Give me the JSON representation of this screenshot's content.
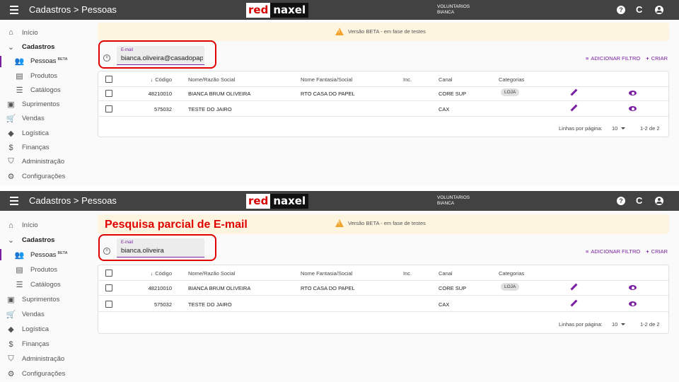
{
  "topbar": {
    "title": "Cadastros > Pessoas",
    "logo_red": "red",
    "logo_dark": "naxel",
    "user_line1": "VOLUNTARIOS",
    "user_line2": "BIANCA",
    "help_icon": "?",
    "refresh_icon": "C"
  },
  "sidebar": {
    "items": [
      {
        "label": "Início",
        "icon": "home-icon",
        "glyph": "⌂"
      },
      {
        "label": "Cadastros",
        "icon": "chevron-down-icon",
        "glyph": "⌄"
      },
      {
        "label": "Pessoas",
        "icon": "people-icon",
        "glyph": "👥",
        "badge": "BETA"
      },
      {
        "label": "Produtos",
        "icon": "book-icon",
        "glyph": "▤"
      },
      {
        "label": "Catálogos",
        "icon": "list-icon",
        "glyph": "☰"
      },
      {
        "label": "Suprimentos",
        "icon": "box-icon",
        "glyph": "▣"
      },
      {
        "label": "Vendas",
        "icon": "cart-icon",
        "glyph": "🛒"
      },
      {
        "label": "Logística",
        "icon": "directions-icon",
        "glyph": "◆"
      },
      {
        "label": "Finanças",
        "icon": "money-icon",
        "glyph": "$"
      },
      {
        "label": "Administração",
        "icon": "shield-icon",
        "glyph": "⛉"
      },
      {
        "label": "Configurações",
        "icon": "gear-icon",
        "glyph": "⚙"
      }
    ]
  },
  "banner": {
    "text": "Versão BETA - em fase de testes"
  },
  "annotation": "Pesquisa parcial de E-mail",
  "filter": {
    "label": "E-mail",
    "value_top": "bianca.oliveira@casadopap",
    "value_bottom": "bianca.oliveira"
  },
  "actions": {
    "add_filter": "ADICIONAR FILTRO",
    "create": "CRIAR"
  },
  "table": {
    "headers": {
      "code": "Código",
      "name": "Nome/Razão Social",
      "fantasy": "Nome Fantasia/Social",
      "inc": "Inc.",
      "canal": "Canal",
      "cat": "Categorias"
    },
    "rows": [
      {
        "code": "48210010",
        "name": "BIANCA BRUM OLIVEIRA",
        "fantasy": "RTO CASA DO PAPEL",
        "inc": "",
        "canal": "CORE SUP",
        "category": "LOJA"
      },
      {
        "code": "575032",
        "name": "TESTE DO JAIRO",
        "fantasy": "",
        "inc": "",
        "canal": "CAX",
        "category": ""
      }
    ],
    "footer": {
      "rows_per_page_label": "Linhas por página:",
      "rows_per_page": "10",
      "range": "1-2 de 2"
    }
  },
  "colors": {
    "accent": "#7b1fa2",
    "topbar": "#424242",
    "highlight": "#e00000",
    "banner": "#fdf5e0"
  }
}
